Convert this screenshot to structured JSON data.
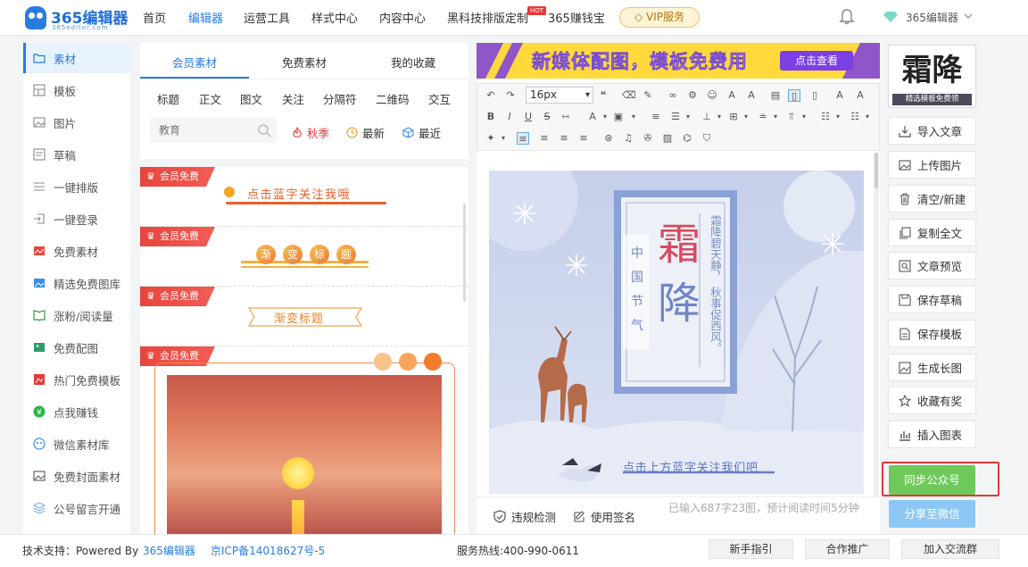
{
  "header": {
    "logo_text": "365编辑器",
    "logo_sub": "365editor.com",
    "nav": [
      "首页",
      "编辑器",
      "运营工具",
      "样式中心",
      "内容中心",
      "黑科技排版定制"
    ],
    "hot_badge": "HOT",
    "nav_extra": "365赚钱宝",
    "vip_label": "VIP服务",
    "user_name": "365编辑器"
  },
  "sidebar": {
    "items": [
      {
        "label": "素材",
        "icon": "folder-icon"
      },
      {
        "label": "模板",
        "icon": "layout-icon"
      },
      {
        "label": "图片",
        "icon": "image-icon"
      },
      {
        "label": "草稿",
        "icon": "draft-icon"
      },
      {
        "label": "一键排版",
        "icon": "list-icon"
      },
      {
        "label": "一键登录",
        "icon": "login-icon"
      },
      {
        "label": "免费素材",
        "icon": "free-material-icon"
      },
      {
        "label": "精选免费图库",
        "icon": "gallery-icon"
      },
      {
        "label": "涨粉/阅读量",
        "icon": "book-icon"
      },
      {
        "label": "免费配图",
        "icon": "picture-icon"
      },
      {
        "label": "热门免费模板",
        "icon": "hot-template-icon"
      },
      {
        "label": "点我赚钱",
        "icon": "yen-icon"
      },
      {
        "label": "微信素材库",
        "icon": "wechat-icon"
      },
      {
        "label": "免费封面素材",
        "icon": "cover-icon"
      },
      {
        "label": "公号留言开通",
        "icon": "layers-icon"
      }
    ]
  },
  "material": {
    "tabs": [
      "会员素材",
      "免费素材",
      "我的收藏"
    ],
    "categories": [
      "标题",
      "正文",
      "图文",
      "关注",
      "分隔符",
      "二维码",
      "交互"
    ],
    "search_placeholder": "教育",
    "filters": [
      "秋季",
      "最新",
      "最近"
    ],
    "badge": "会员免费",
    "cards": [
      {
        "text": "点击蓝字关注我哦"
      },
      {
        "chars": [
          "渐",
          "变",
          "标",
          "题"
        ]
      },
      {
        "text": "渐变标题"
      }
    ]
  },
  "editor": {
    "banner_text": "新媒体配图，模板免费用",
    "banner_button": "点击查看",
    "font_size": "16px",
    "poster": {
      "title_chars": [
        "霜",
        "降"
      ],
      "side_chars": [
        "中",
        "国",
        "节",
        "气"
      ],
      "poem_col1": "霜降碧天静，",
      "poem_col2": "秋事促西风。",
      "follow_text": "点击上方蓝字关注我们吧"
    },
    "footer": {
      "check_label": "违规检测",
      "sign_label": "使用签名",
      "status": "已输入687字23图，预计阅读时间5分钟"
    }
  },
  "right": {
    "thumb_title": "霜降",
    "thumb_caption": "精选模板免费领",
    "buttons": [
      {
        "label": "导入文章",
        "icon": "import-icon"
      },
      {
        "label": "上传图片",
        "icon": "upload-image-icon"
      },
      {
        "label": "清空/新建",
        "icon": "trash-icon"
      },
      {
        "label": "复制全文",
        "icon": "copy-icon"
      },
      {
        "label": "文章预览",
        "icon": "preview-icon"
      },
      {
        "label": "保存草稿",
        "icon": "save-icon"
      },
      {
        "label": "保存模板",
        "icon": "template-icon"
      },
      {
        "label": "生成长图",
        "icon": "long-image-icon"
      },
      {
        "label": "收藏有奖",
        "icon": "star-icon"
      },
      {
        "label": "插入图表",
        "icon": "chart-icon"
      }
    ],
    "sync_label": "同步公众号",
    "share_label": "分享至微信"
  },
  "footer": {
    "tech_prefix": "技术支持：Powered By",
    "tech_link": "365编辑器",
    "icp": "京ICP备14018627号-5",
    "hotline": "服务热线:400-990-0611",
    "buttons": [
      "新手指引",
      "合作推广",
      "加入交流群"
    ]
  },
  "colors": {
    "accent": "#2a7be0",
    "badge_red": "#e8453c",
    "sync_green": "#6fc95a",
    "share_blue": "#8cc8f5"
  }
}
